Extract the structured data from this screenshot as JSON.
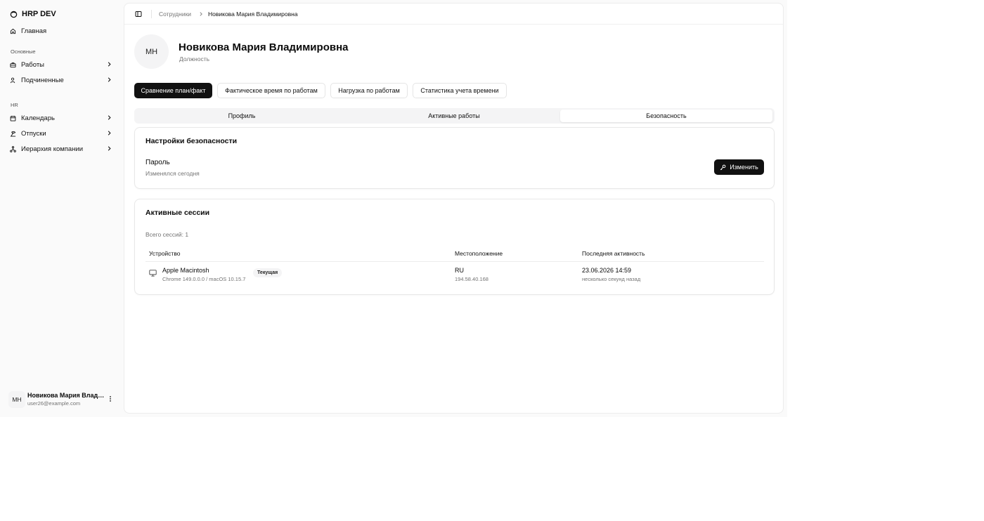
{
  "sidebar": {
    "brand": "HRP DEV",
    "home": "Главная",
    "group_main": "Основные",
    "works": "Работы",
    "subordinates": "Подчиненные",
    "group_hr": "HR",
    "calendar": "Календарь",
    "vacations": "Отпуски",
    "hierarchy": "Иерархия компании",
    "user": {
      "initials": "МН",
      "name": "Новикова Мария Влади...",
      "email": "user26@example.com"
    }
  },
  "breadcrumb": {
    "parent": "Сотрудники",
    "current": "Новикова Мария Владимировна"
  },
  "employee": {
    "initials": "МН",
    "name": "Новикова Мария Владимировна",
    "position": "Должность"
  },
  "actions": [
    "Сравнение план/факт",
    "Фактическое время по работам",
    "Нагрузка по работам",
    "Статистика учета времени"
  ],
  "tabs": [
    "Профиль",
    "Активные работы",
    "Безопасность"
  ],
  "active_tab": "Безопасность",
  "security": {
    "title": "Настройки безопасности",
    "password_label": "Пароль",
    "password_changed": "Изменялся сегодня",
    "change_button": "Изменить"
  },
  "sessions": {
    "title": "Активные сессии",
    "count": "Всего сессий: 1",
    "columns": [
      "Устройство",
      "Местоположение",
      "Последняя активность"
    ],
    "rows": [
      {
        "device": "Apple Macintosh",
        "device_sub": "Chrome 149.0.0.0 / macOS 10.15.7",
        "badge": "Текущая",
        "location": "RU",
        "ip": "194.58.40.168",
        "last_active": "23.06.2026 14:59",
        "last_active_rel": "несколько секунд назад"
      }
    ]
  },
  "icons": {
    "brand": "logo-circle-icon",
    "home": "home-icon",
    "works": "briefcase-icon",
    "subordinates": "user-icon",
    "calendar": "calendar-icon",
    "vacations": "vacation-icon",
    "hierarchy": "network-icon",
    "chevron": "chevron-right-icon",
    "menu": "more-vertical-icon",
    "toggle": "sidebar-toggle-icon",
    "key": "key-icon",
    "monitor": "monitor-icon"
  }
}
